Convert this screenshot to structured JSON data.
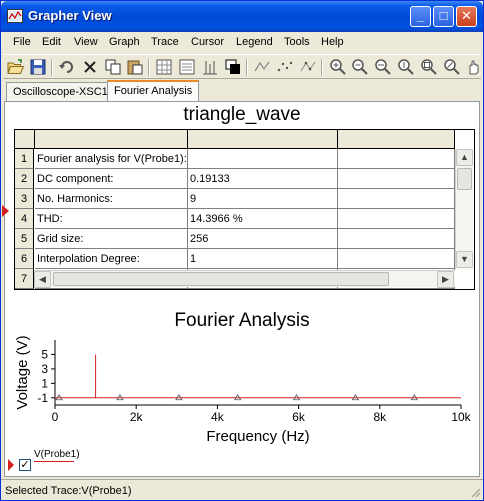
{
  "window": {
    "title": "Grapher View",
    "title_color": "#0a5ce8"
  },
  "title_buttons": {
    "minimize": "_",
    "maximize": "□",
    "close": "✕"
  },
  "menu": {
    "items": [
      "File",
      "Edit",
      "View",
      "Graph",
      "Trace",
      "Cursor",
      "Legend",
      "Tools",
      "Help"
    ]
  },
  "toolbar": {
    "icons": [
      "open-folder-icon",
      "save-icon",
      "undo-icon",
      "delete-icon",
      "copy-icon",
      "paste-icon",
      "grid-icon",
      "legend-icon",
      "cursors-icon",
      "overlay-icon",
      "select-marks-icon",
      "scatter-marks-icon",
      "line-marks-icon",
      "zoom-in-icon",
      "zoom-out-icon",
      "zoom-x-icon",
      "zoom-y-icon",
      "zoom-full-icon",
      "zoom-toggle-icon",
      "pan-icon"
    ]
  },
  "tabs": [
    {
      "label": "Oscilloscope-XSC1",
      "active": false
    },
    {
      "label": "Fourier Analysis",
      "active": true
    }
  ],
  "sheet": {
    "title": "triangle_wave"
  },
  "table": {
    "rows": [
      {
        "num": "1",
        "label": "Fourier analysis for V(Probe1):",
        "value": "",
        "extra": ""
      },
      {
        "num": "2",
        "label": "DC component:",
        "value": "0.19133",
        "extra": ""
      },
      {
        "num": "3",
        "label": "No. Harmonics:",
        "value": "9",
        "extra": ""
      },
      {
        "num": "4",
        "label": "THD:",
        "value": "14.3966 %",
        "extra": ""
      },
      {
        "num": "5",
        "label": "Grid size:",
        "value": "256",
        "extra": ""
      },
      {
        "num": "6",
        "label": "Interpolation Degree:",
        "value": "1",
        "extra": ""
      },
      {
        "num": "7",
        "label": "",
        "value": "",
        "extra": ""
      }
    ]
  },
  "chart_data": {
    "type": "line",
    "title": "Fourier Analysis",
    "xlabel": "Frequency (Hz)",
    "ylabel": "Voltage (V)",
    "xlim": [
      0,
      10000
    ],
    "ylim": [
      -2,
      7
    ],
    "x_ticks": [
      0,
      2000,
      4000,
      6000,
      8000,
      10000
    ],
    "x_tick_labels": [
      "0",
      "2k",
      "4k",
      "6k",
      "8k",
      "10k"
    ],
    "y_ticks": [
      -1,
      1,
      3,
      5
    ],
    "y_tick_labels": [
      "-1",
      "1",
      "3",
      "5"
    ],
    "grid": false,
    "line_color": "#d52020",
    "series": [
      {
        "name": "V(Probe1)",
        "color": "#d52020",
        "x": [
          0,
          1000,
          1000,
          1000,
          10000
        ],
        "y": [
          -1,
          -1,
          5,
          -1,
          -1
        ],
        "markers_x": [
          100,
          1600,
          3050,
          4500,
          5950,
          7400,
          8850
        ],
        "markers_y": [
          -1,
          -1,
          -1,
          -1,
          -1,
          -1,
          -1
        ]
      }
    ]
  },
  "legend": {
    "label": "V(Probe1)",
    "checked": true,
    "check_glyph": "✓"
  },
  "status": {
    "text": "Selected Trace:V(Probe1)"
  }
}
